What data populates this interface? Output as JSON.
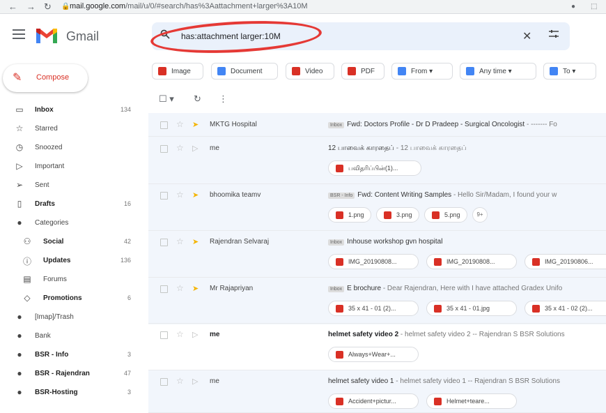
{
  "browser": {
    "url_host": "mail.google.com",
    "url_path": "/mail/u/0/#search/has%3Aattachment+larger%3A10M"
  },
  "app": {
    "name": "Gmail"
  },
  "search": {
    "value": "has:attachment larger:10M"
  },
  "compose": {
    "label": "Compose"
  },
  "sidebar": [
    {
      "label": "Inbox",
      "count": "134",
      "icon": "inbox-icon",
      "bold": true
    },
    {
      "label": "Starred",
      "count": "",
      "icon": "star-icon",
      "bold": false
    },
    {
      "label": "Snoozed",
      "count": "",
      "icon": "clock-icon",
      "bold": false
    },
    {
      "label": "Important",
      "count": "",
      "icon": "important-icon",
      "bold": false
    },
    {
      "label": "Sent",
      "count": "",
      "icon": "send-icon",
      "bold": false
    },
    {
      "label": "Drafts",
      "count": "16",
      "icon": "draft-icon",
      "bold": true
    },
    {
      "label": "Categories",
      "count": "",
      "icon": "label-icon",
      "bold": false
    },
    {
      "label": "Social",
      "count": "42",
      "icon": "people-icon",
      "bold": true,
      "sub": true
    },
    {
      "label": "Updates",
      "count": "136",
      "icon": "info-icon",
      "bold": true,
      "sub": true
    },
    {
      "label": "Forums",
      "count": "",
      "icon": "forum-icon",
      "bold": false,
      "sub": true
    },
    {
      "label": "Promotions",
      "count": "6",
      "icon": "tag-icon",
      "bold": true,
      "sub": true
    },
    {
      "label": "[Imap]/Trash",
      "count": "",
      "icon": "label-icon",
      "bold": false
    },
    {
      "label": "Bank",
      "count": "",
      "icon": "label-icon",
      "bold": false
    },
    {
      "label": "BSR - Info",
      "count": "3",
      "icon": "label-icon",
      "bold": true
    },
    {
      "label": "BSR - Rajendran",
      "count": "47",
      "icon": "label-icon",
      "bold": true
    },
    {
      "label": "BSR-Hosting",
      "count": "3",
      "icon": "label-icon",
      "bold": true
    }
  ],
  "filters": [
    {
      "label": "Image",
      "color": "#d93025"
    },
    {
      "label": "Document",
      "color": "#4285f4"
    },
    {
      "label": "Video",
      "color": "#d93025"
    },
    {
      "label": "PDF",
      "color": "#d93025"
    },
    {
      "label": "From ▾",
      "color": "#4285f4"
    },
    {
      "label": "Any time ▾",
      "color": "#4285f4"
    },
    {
      "label": "To ▾",
      "color": "#4285f4"
    }
  ],
  "toolbar": {
    "select": "☐ ▾",
    "refresh": "↻",
    "more": "⋮"
  },
  "emails": [
    {
      "sender": "MKTG Hospital",
      "tag": "Inbox",
      "subject": "Fwd: Doctors Profile - Dr D Pradeep - Surgical Oncologist",
      "snippet": " - ------- Fo",
      "attachments": [],
      "unread": false,
      "important": true
    },
    {
      "sender": "me",
      "tag": "",
      "subject": "12 பாவைக் காரதைப்",
      "snippet": " - 12 பாவைக் காரதைப்",
      "attachments": [
        "பவிதரிப்பின்(1)..."
      ],
      "unread": false,
      "important": false
    },
    {
      "sender": "bhoomika teamv",
      "tag": "BSR - Info",
      "subject": "Fwd: Content Writing Samples",
      "snippet": " - Hello Sir/Madam, I found your w",
      "attachments": [
        "1.png",
        "3.png",
        "5.png"
      ],
      "more": "9+",
      "unread": false,
      "important": true
    },
    {
      "sender": "Rajendran Selvaraj",
      "tag": "Inbox",
      "subject": "Inhouse workshop gvn hospital",
      "snippet": "",
      "attachments": [
        "IMG_20190808...",
        "IMG_20190808...",
        "IMG_20190806..."
      ],
      "unread": false,
      "important": true
    },
    {
      "sender": "Mr Rajapriyan",
      "tag": "Inbox",
      "subject": "E brochure",
      "snippet": " - Dear Rajendran, Here with I have attached Gradex Unifo",
      "attachments": [
        "35 x 41 - 01 (2)...",
        "35 x 41 - 01.jpg",
        "35 x 41 - 02 (2)..."
      ],
      "unread": false,
      "important": true
    },
    {
      "sender": "me",
      "tag": "",
      "subject": "helmet safety video 2",
      "snippet": " - helmet safety video 2 -- Rajendran S BSR Solutions",
      "attachments": [
        "Always+Wear+..."
      ],
      "unread": true,
      "important": false
    },
    {
      "sender": "me",
      "tag": "",
      "subject": "helmet safety video 1",
      "snippet": " - helmet safety video 1 -- Rajendran S BSR Solutions",
      "attachments": [
        "Accident+pictur...",
        "Helmet+teare..."
      ],
      "unread": false,
      "important": false
    }
  ]
}
